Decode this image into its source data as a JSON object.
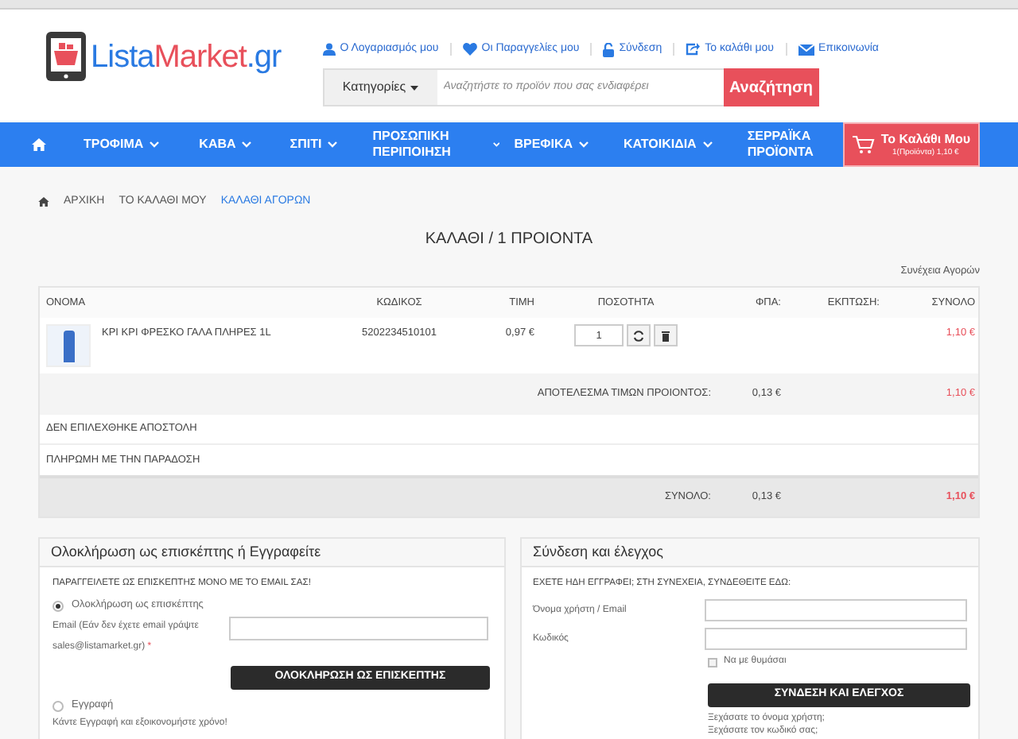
{
  "logo": {
    "part_1": "Lista",
    "part_2": "Market",
    "part_3": ".gr"
  },
  "top_links": [
    {
      "label": "Ο Λογαριασμός μου",
      "kind": "user"
    },
    {
      "label": "Οι Παραγγελίες μου",
      "kind": "heart"
    },
    {
      "label": "Σύνδεση",
      "kind": "lock"
    },
    {
      "label": "Το καλάθι μου",
      "kind": "share"
    },
    {
      "label": "Επικοινωνία",
      "kind": "mail"
    }
  ],
  "search": {
    "category_label": "Κατηγορίες",
    "placeholder": "Αναζητήστε το προϊόν που σας ενδιαφέρει",
    "button": "Αναζήτηση"
  },
  "nav": {
    "items": [
      {
        "label": "ΤΡΟΦΙΜΑ",
        "dropdown": true
      },
      {
        "label": "ΚΑΒΑ",
        "dropdown": true
      },
      {
        "label": "ΣΠΙΤΙ",
        "dropdown": true
      },
      {
        "label": "ΠΡΟΣΩΠΙΚΗ ΠΕΡΙΠΟΙΗΣΗ",
        "dropdown": true
      },
      {
        "label": "ΒΡΕΦΙΚΑ",
        "dropdown": true
      },
      {
        "label": "ΚΑΤΟΙΚΙΔΙΑ",
        "dropdown": true
      },
      {
        "label": "ΣΕΡΡΑΪΚΑ ΠΡΟΪΟΝΤΑ",
        "dropdown": false
      }
    ],
    "cart": {
      "title": "Το Καλάθι Μου",
      "summary": "1(Προϊόντα) 1,10 €"
    }
  },
  "breadcrumb": [
    {
      "label": "ΑΡΧΙΚΗ",
      "current": false
    },
    {
      "label": "ΤΟ ΚΑΛΑΘΙ ΜΟΥ",
      "current": false
    },
    {
      "label": "ΚΑΛΑΘΙ ΑΓΟΡΩΝ",
      "current": true
    }
  ],
  "page_title": "ΚΑΛΑΘΙ / 1 ΠΡΟΙΟΝΤΑ",
  "continue_link": "Συνέχεια Αγορών",
  "table": {
    "columns": [
      "ΟΝΟΜΑ",
      "ΚΩΔΙΚΟΣ",
      "ΤΙΜΗ",
      "ΠΟΣΟΤΗΤΑ",
      "ΦΠΑ:",
      "ΕΚΠΤΩΣΗ:",
      "ΣΥΝΟΛΟ"
    ],
    "rows": [
      {
        "name": "ΚΡΙ ΚΡΙ ΦΡΕΣΚΟ ΓΑΛΑ ΠΛΗΡΕΣ 1L",
        "code": "5202234510101",
        "price": "0,97 €",
        "quantity": "1",
        "total": "1,10 €"
      }
    ],
    "subtotal": {
      "label": "ΑΠΟΤΕΛΕΣΜΑ ΤΙΜΩΝ ΠΡΟΙΟΝΤΟΣ:",
      "vat": "0,13 €",
      "total": "1,10 €"
    },
    "shipping": "ΔΕΝ ΕΠΙΛΕΧΘΗΚΕ ΑΠΟΣΤΟΛΗ",
    "payment": "ΠΛΗΡΩΜΗ ΜΕ ΤΗΝ ΠΑΡΑΔΟΣΗ",
    "grand_total": {
      "label": "ΣΥΝΟΛΟ:",
      "vat": "0,13 €",
      "total": "1,10 €"
    }
  },
  "guest_panel": {
    "title": "Ολοκλήρωση ως επισκέπτης ή Εγγραφείτε",
    "intro": "ΠΑΡΑΓΓΕΙΛΕΤΕ ΩΣ ΕΠΙΣΚΕΠΤΗΣ ΜΟΝΟ ΜΕ ΤΟ EMAIL ΣΑΣ!",
    "options": [
      {
        "label": "Ολοκλήρωση ως επισκέπτης",
        "selected": true
      },
      {
        "label": "Εγγραφή",
        "selected": false
      }
    ],
    "email_label": "Email (Εάν δεν έχετε email γράψτε sales@listamarket.gr)",
    "required_mark": "*",
    "button": "ΟΛΟΚΛΗΡΩΣΗ ΩΣ ΕΠΙΣΚΕΠΤΗΣ",
    "register_text": "Κάντε Εγγραφή και εξοικονομήστε χρόνο!"
  },
  "login_panel": {
    "title": "Σύνδεση και έλεγχος",
    "intro": "ΕΧΕΤΕ ΗΔΗ ΕΓΓΡΑΦΕΙ; ΣΤΗ ΣΥΝΕΧΕΙΑ, ΣΥΝΔΕΘΕΙΤΕ ΕΔΩ:",
    "username_label": "Όνομα χρήστη / Email",
    "password_label": "Κωδικός",
    "remember": {
      "label": "Να με θυμάσαι",
      "checked": false
    },
    "button": "ΣΥΝΔΕΣΗ ΚΑΙ ΕΛΕΓΧΟΣ",
    "links": [
      "Ξεχάσατε το όνομα χρήστη;",
      "Ξεχάσατε τον κωδικό σας;"
    ]
  }
}
